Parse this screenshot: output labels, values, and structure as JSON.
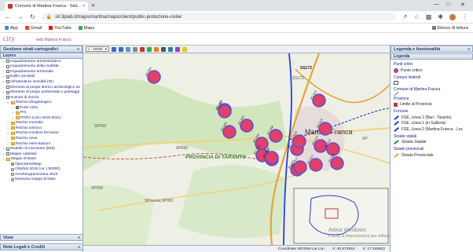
{
  "browser": {
    "tab_title": "Comune di Martina Franca - Sist...",
    "tab_close": "×",
    "new_tab": "+",
    "url": "sit.3plab.it/maps/martina/maps/client/public-protezione-civile/",
    "bookmarks": [
      "App",
      "Gmail",
      "YouTube",
      "Maps"
    ],
    "reading_list": "Elenco di lettura"
  },
  "app": {
    "logo_text": "city",
    "logo_sub": "web Martina Franca"
  },
  "left_panel": {
    "title": "Gestione strati cartografici",
    "layers_header": "Layers",
    "layers": [
      {
        "label": "Inquadramento amministrativo",
        "kind": "cb",
        "depth": 0
      },
      {
        "label": "Inquadramento della mobilità",
        "kind": "cb",
        "depth": 0
      },
      {
        "label": "Inquadramento territoriale",
        "kind": "cb",
        "depth": 0
      },
      {
        "label": "Edifici sensibili",
        "kind": "cb",
        "depth": 0
      },
      {
        "label": "Infrastrutture sensibili (IR)",
        "kind": "cb",
        "depth": 0
      },
      {
        "label": "Elementi di pregio storico archeologico an",
        "kind": "cb",
        "depth": 0
      },
      {
        "label": "Elementi di pregio ambientale e paesaggi",
        "kind": "cb",
        "depth": 0
      },
      {
        "label": "Scenari di rischio",
        "kind": "cb",
        "depth": 0
      },
      {
        "label": "Rischio idrogeologico",
        "kind": "fd",
        "depth": 1
      },
      {
        "label": "Punti critici",
        "kind": "cbon",
        "depth": 2
      },
      {
        "label": "PAI",
        "kind": "fd",
        "depth": 2
      },
      {
        "label": "PGRA (ciclo 2016-2021)",
        "kind": "fd",
        "depth": 2
      },
      {
        "label": "Rischio incendio",
        "kind": "fd",
        "depth": 1
      },
      {
        "label": "Rischio sismico",
        "kind": "fd",
        "depth": 1
      },
      {
        "label": "Rischio incidenti ferroviari",
        "kind": "fd",
        "depth": 1
      },
      {
        "label": "Rischio neve",
        "kind": "fd",
        "depth": 1
      },
      {
        "label": "Rischio esercitazioni",
        "kind": "fd",
        "depth": 1
      },
      {
        "label": "Modello di intervento (MdI)",
        "kind": "cb",
        "depth": 0
      },
      {
        "label": "Mappe catastali",
        "kind": "cb",
        "depth": 0
      },
      {
        "label": "Mappe di Base",
        "kind": "fd",
        "depth": 0
      },
      {
        "label": "OpenStreetMap",
        "kind": "rdon",
        "depth": 1
      },
      {
        "label": "Ortofoto 2016 (ca 1:50000)",
        "kind": "rd",
        "depth": 1
      },
      {
        "label": "Aerofotogrammetria 2015",
        "kind": "rd",
        "depth": 1
      },
      {
        "label": "Nessuna mappa di base",
        "kind": "rd",
        "depth": 1
      }
    ],
    "views_header": "Viste",
    "legal_header": "Note Legali e Crediti"
  },
  "map": {
    "scale": "1 : 50000",
    "labels": {
      "city": "Martina Franca",
      "province": "PROVINCIA DI TARANTO",
      "ss172": "SS172",
      "ss172b": "SS172",
      "sp069": "SP069",
      "sp060": "SP060",
      "sp058": "SP058",
      "spnuova": "SPnuova,SP081",
      "sp": "SP"
    },
    "markers": [
      "PC 001",
      "PC 002",
      "PC 003",
      "PC 004",
      "PC 005",
      "PC 006",
      "PC 007",
      "PC 008",
      "PC 009",
      "PC 010",
      "PC 011",
      "PC 012",
      "PC 013",
      "PC 014",
      "PC 015",
      "PC 016",
      "PC 017",
      "PC 018",
      "PC 019",
      "PC 020"
    ],
    "footer_label": "Coordinate WGS84-Lat Lon",
    "footer_x": "X: 40.673544",
    "footer_y": "X: 17.346602",
    "windows_line1": "Attiva Windows",
    "windows_line2": "Passa a Impostazioni per attivare Windows."
  },
  "right_panel": {
    "title": "Legenda e funzionalità",
    "legend_header": "Legenda",
    "groups": [
      {
        "heading": "Punti critici",
        "items": [
          {
            "label": "Punto critico",
            "sym": "dot"
          }
        ]
      },
      {
        "heading": "Comuni limitrofi",
        "items": [
          {
            "label": "",
            "sym": "box"
          }
        ]
      },
      {
        "heading": "Comune di Martina Franca",
        "items": [
          {
            "label": "",
            "sym": "line-gray"
          }
        ]
      },
      {
        "heading": "Province",
        "items": [
          {
            "label": "Limite di Provincia",
            "sym": "sq-red"
          }
        ]
      },
      {
        "heading": "Ferrovie",
        "items": [
          {
            "label": "FSE, Linea 1 (Bari - Taranto)",
            "sym": "line-blue"
          },
          {
            "label": "FSE, Linea 1 (in Galleria)",
            "sym": "line-blue"
          },
          {
            "label": "FSE, Linea 2 (Martina Franca - Lec",
            "sym": "line-blue"
          }
        ]
      },
      {
        "heading": "Strade statali",
        "items": [
          {
            "label": "Strada Statale",
            "sym": "line-green"
          }
        ]
      },
      {
        "heading": "Strade provinciali",
        "items": [
          {
            "label": "Strada Provinciale",
            "sym": "line-orange"
          }
        ]
      }
    ]
  },
  "colors": {
    "marker_fill": "#e0406a",
    "marker_ring": "#5a4fd1",
    "rail": "#2b3fd6",
    "road_state": "#e8a33a",
    "province_border": "#c0392b",
    "panel_header": "#1a3d6e"
  }
}
